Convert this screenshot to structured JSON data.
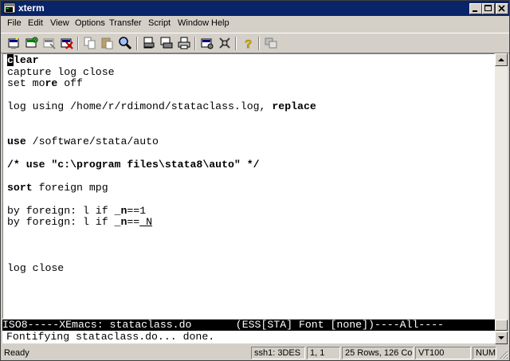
{
  "window": {
    "title": "xterm"
  },
  "menu": [
    "File",
    "Edit",
    "View",
    "Options",
    "Transfer",
    "Script",
    "Window",
    "Help"
  ],
  "toolbar": [
    {
      "name": "new-session-icon"
    },
    {
      "name": "reconnect-icon"
    },
    {
      "name": "disconnect-icon"
    },
    {
      "name": "close-connection-icon"
    },
    {
      "name": "copy-icon"
    },
    {
      "name": "paste-icon"
    },
    {
      "name": "find-icon"
    },
    {
      "name": "print-setup-icon"
    },
    {
      "name": "print-screen-icon"
    },
    {
      "name": "print-icon"
    },
    {
      "name": "session-options-icon"
    },
    {
      "name": "global-options-icon"
    },
    {
      "name": "help-icon"
    },
    {
      "name": "about-icon"
    }
  ],
  "editor": {
    "cursor_char": "c",
    "line1_rest": "lear",
    "line2": "capture log close",
    "line3_a": "set mo",
    "line3_b": "re",
    "line3_c": " off",
    "line5_a": "log using /home/r/rdimond/stataclass.log, ",
    "line5_b": "replace",
    "line8_a": "use",
    "line8_b": " /software/stata/auto",
    "line10": "/* use \"c:\\program files\\stata8\\auto\" */",
    "line12_a": "sort",
    "line12_b": " foreign mpg",
    "line14_a": "by foreign: l if _",
    "line14_b": "n",
    "line14_c": "==1",
    "line15_a": "by foreign: l if _",
    "line15_b": "n",
    "line15_c": "==",
    "line15_d": "_N",
    "line19": "log close"
  },
  "modeline": "ISO8-----XEmacs: stataclass.do       (ESS[STA] Font [none])----All----",
  "echo": "Fontifying stataclass.do... done.",
  "status": {
    "ready": "Ready",
    "cipher": "ssh1: 3DES",
    "position": "1,  1",
    "size": "25 Rows, 126 Cols",
    "term": "VT100",
    "num": "NUM"
  }
}
